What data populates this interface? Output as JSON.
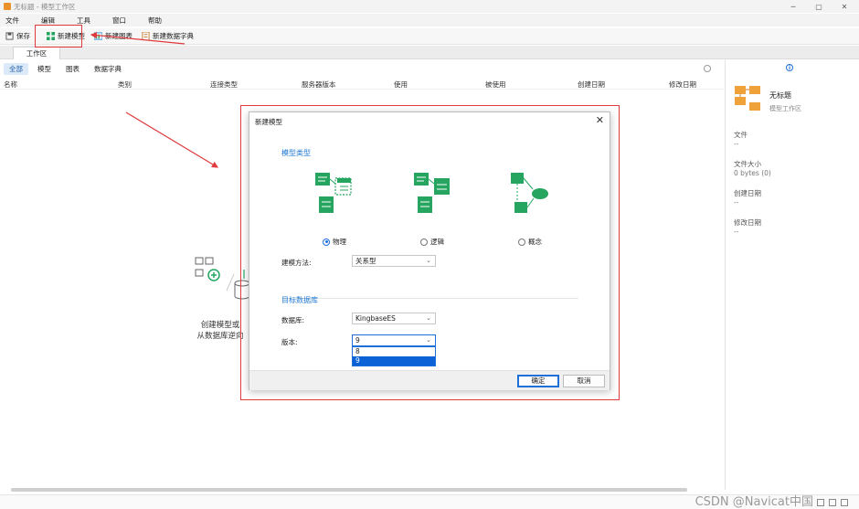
{
  "window": {
    "title": "无标题 - 模型工作区"
  },
  "menu": [
    "文件",
    "编辑",
    "工具",
    "窗口",
    "帮助"
  ],
  "toolbar": {
    "save": "保存",
    "new_model": "新建模型",
    "new_chart": "新建图表",
    "new_dict": "新建数据字典"
  },
  "workspace_tab": "工作区",
  "filters": [
    "全部",
    "模型",
    "图表",
    "数据字典"
  ],
  "columns": [
    "名称",
    "类别",
    "连接类型",
    "服务器版本",
    "使用",
    "被使用",
    "创建日期",
    "修改日期"
  ],
  "empty_state": {
    "line1": "创建模型或",
    "line2": "从数据库逆向"
  },
  "side_panel": {
    "name": "无标题",
    "subtitle": "模型工作区",
    "file_label": "文件",
    "file_value": "--",
    "size_label": "文件大小",
    "size_value": "0 bytes (0)",
    "created_label": "创建日期",
    "created_value": "--",
    "modified_label": "修改日期",
    "modified_value": "--"
  },
  "dialog": {
    "title": "新建模型",
    "section_model_type": "模型类型",
    "types": [
      {
        "label": "物理",
        "checked": true
      },
      {
        "label": "逻辑",
        "checked": false
      },
      {
        "label": "概念",
        "checked": false
      }
    ],
    "method_label": "建模方法:",
    "method_value": "关系型",
    "section_target": "目标数据库",
    "db_label": "数据库:",
    "db_value": "KingbaseES",
    "version_label": "版本:",
    "version_value": "9",
    "version_options": [
      "8",
      "9"
    ],
    "version_selected": "9",
    "ok": "确定",
    "cancel": "取消"
  },
  "watermark": "CSDN @Navicat中国",
  "colors": {
    "accent": "#1e6fd9",
    "highlight": "#e0393e",
    "icon_green": "#25a55f"
  }
}
